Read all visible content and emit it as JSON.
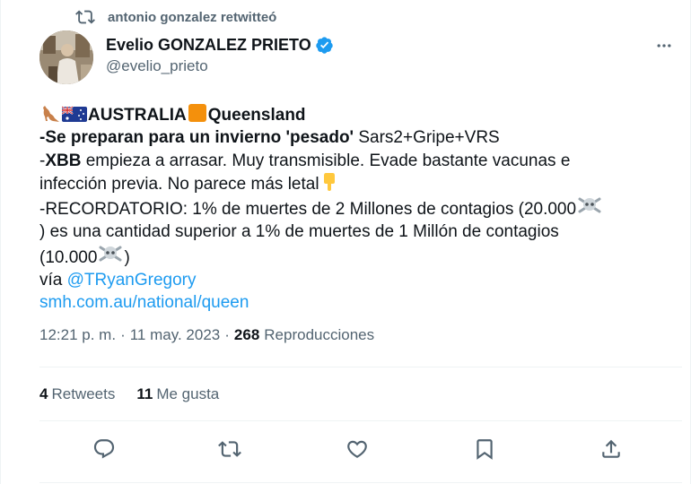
{
  "retweet": {
    "icon": "retweet-icon",
    "text": "antonio gonzalez retwitteó"
  },
  "author": {
    "name": "Evelio GONZALEZ PRIETO",
    "handle": "@evelio_prieto",
    "verified_icon": "verified-badge-icon",
    "verified_color": "#1d9bf0"
  },
  "more_icon": "more-options-icon",
  "tweet": {
    "line1": {
      "title_a": "AUSTRALIA",
      "title_b": "Queensland"
    },
    "line2": {
      "bold": "-Se preparan para un invierno 'pesado'",
      "rest": " Sars2+Gripe+VRS"
    },
    "line3": {
      "prefix": "-",
      "bold": "XBB",
      "rest": " empieza a arrasar. Muy transmisible. Evade bastante vacunas e"
    },
    "line4": "infección previa. No parece más letal",
    "line5": "-RECORDATORIO: 1% de muertes de 2 Millones de contagios (20.000",
    "line6": ") es una cantidad superior a 1% de muertes de 1 Millón de contagios",
    "line7": "(10.000",
    "line7_end": ")",
    "line8": {
      "prefix": "vía ",
      "mention": "@TRyanGregory"
    },
    "line9": "smh.com.au/national/queen",
    "emojis": [
      "kangaroo",
      "australia-flag",
      "orange-square",
      "backhand-index-pointing-down",
      "skull-and-crossbones"
    ]
  },
  "meta": {
    "time": "12:21 p. m.",
    "sep1": "·",
    "date": "11 may. 2023",
    "sep2": "·",
    "views_count": "268",
    "views_label": "Reproducciones"
  },
  "stats": {
    "retweets_count": "4",
    "retweets_label": "Retweets",
    "likes_count": "11",
    "likes_label": "Me gusta"
  },
  "actions": [
    "reply-icon",
    "retweet-icon",
    "like-icon",
    "bookmark-icon",
    "share-icon"
  ],
  "colors": {
    "text": "#0f1419",
    "secondary": "#536471",
    "link": "#1d9bf0",
    "divider": "#eff3f4"
  }
}
